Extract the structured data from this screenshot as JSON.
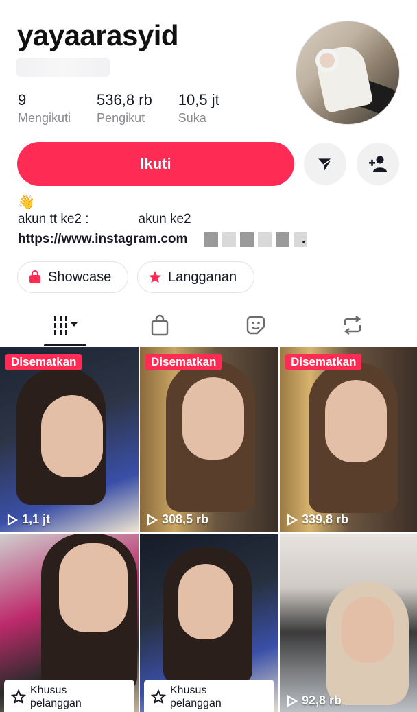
{
  "profile": {
    "username": "yayaarasyid",
    "stats": [
      {
        "value": "9",
        "label": "Mengikuti"
      },
      {
        "value": "536,8 rb",
        "label": "Pengikut"
      },
      {
        "value": "10,5 jt",
        "label": "Suka"
      }
    ],
    "follow_label": "Ikuti",
    "bio_emoji": "👋",
    "bio_line1_start": "akun tt ke2 :",
    "bio_line1_end": "akun ke2",
    "bio_line2": "https://www.instagram.com",
    "bio_line2_end": "."
  },
  "chips": {
    "showcase": "Showcase",
    "langganan": "Langganan"
  },
  "tabs": [
    "videos-grid",
    "shop",
    "favorites",
    "reposts"
  ],
  "videos": [
    {
      "badge": "Disematkan",
      "views": "1,1 jt"
    },
    {
      "badge": "Disematkan",
      "views": "308,5 rb"
    },
    {
      "badge": "Disematkan",
      "views": "339,8 rb"
    },
    {
      "subscriber_label_1": "Khusus",
      "subscriber_label_2": "pelanggan"
    },
    {
      "subscriber_label_1": "Khusus",
      "subscriber_label_2": "pelanggan"
    },
    {
      "views": "92,8 rb"
    }
  ],
  "colors": {
    "accent": "#fe2c55",
    "text": "#161823",
    "muted": "#8a8b91",
    "button_bg": "#f1f1f2"
  }
}
